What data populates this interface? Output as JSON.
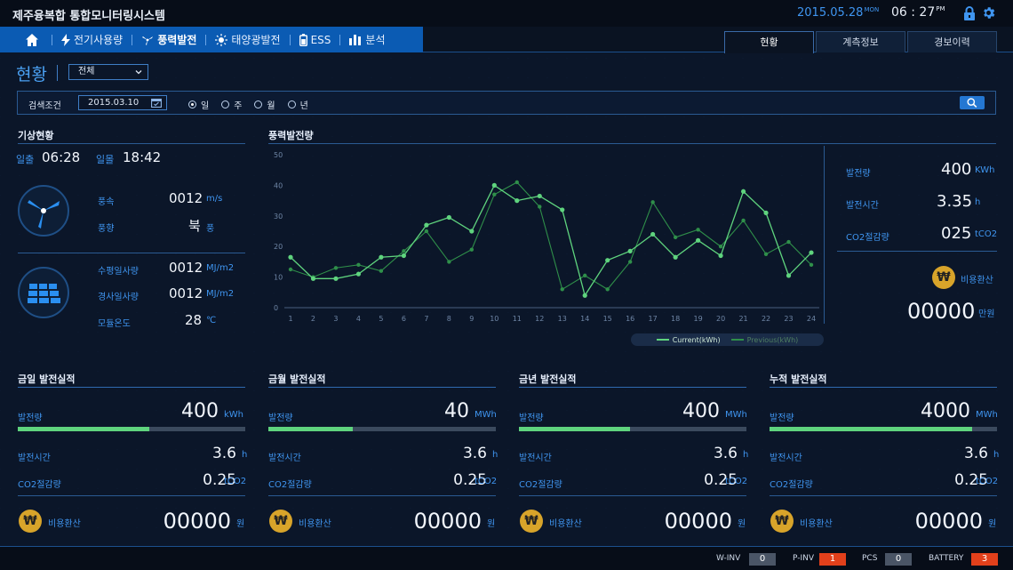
{
  "header": {
    "title": "제주융복합 통합모니터링시스템",
    "date": "2015.05.28",
    "day": "MON",
    "time": "06 : 27",
    "ampm": "PM"
  },
  "nav": {
    "items": [
      {
        "label": "전기사용량",
        "icon": "bolt-icon"
      },
      {
        "label": "풍력발전",
        "icon": "wind-turbine-icon"
      },
      {
        "label": "태양광발전",
        "icon": "sun-icon"
      },
      {
        "label": "ESS",
        "icon": "battery-icon"
      },
      {
        "label": "분석",
        "icon": "bar-chart-icon"
      }
    ],
    "active_index": 1
  },
  "tabs": {
    "items": [
      "현황",
      "계측정보",
      "경보이력"
    ],
    "active_index": 0
  },
  "page": {
    "title": "현황",
    "site_select": "전체"
  },
  "search": {
    "label": "검색조건",
    "date": "2015.03.10",
    "periods": [
      "일",
      "주",
      "월",
      "년"
    ],
    "selected_period": "일"
  },
  "weather": {
    "title": "기상현황",
    "sunrise_label": "일출",
    "sunrise": "06:28",
    "sunset_label": "일몰",
    "sunset": "18:42",
    "wind_speed_label": "풍속",
    "wind_speed": "0012",
    "wind_speed_unit": "m/s",
    "wind_dir_label": "풍향",
    "wind_dir": "북",
    "wind_dir_unit": "풍",
    "horizontal_label": "수평일사량",
    "horizontal": "0012",
    "horizontal_unit": "MJ/m2",
    "inclined_label": "경사일사량",
    "inclined": "0012",
    "inclined_unit": "MJ/m2",
    "module_temp_label": "모듈온도",
    "module_temp": "28",
    "module_temp_unit": "℃"
  },
  "wind_power": {
    "title": "풍력발전량",
    "generation_label": "발전량",
    "generation": "400",
    "generation_unit": "KWh",
    "hours_label": "발전시간",
    "hours": "3.35",
    "hours_unit": "h",
    "co2_label": "CO2절감량",
    "co2": "025",
    "co2_unit": "tCO2",
    "cost_label": "비용환산",
    "cost": "00000",
    "cost_unit": "만원"
  },
  "chart_data": {
    "type": "line",
    "x": [
      1,
      2,
      3,
      4,
      5,
      6,
      7,
      8,
      9,
      10,
      11,
      12,
      13,
      14,
      15,
      16,
      17,
      18,
      19,
      20,
      21,
      22,
      23,
      24
    ],
    "ylim": [
      0,
      50
    ],
    "yticks": [
      0,
      10,
      20,
      30,
      40,
      50
    ],
    "series": [
      {
        "name": "Current(kWh)",
        "color": "#5fd47e",
        "values": [
          16.5,
          9.5,
          9.5,
          11,
          16.5,
          17,
          27,
          29.5,
          25,
          40,
          35,
          36.5,
          32,
          4,
          15.5,
          18.5,
          24,
          16.5,
          22,
          17,
          38,
          31,
          10.5,
          18
        ]
      },
      {
        "name": "Previous(kWh)",
        "color": "#2f8f4a",
        "values": [
          12.5,
          10,
          13,
          14,
          12,
          18.5,
          25,
          15,
          19,
          37,
          41,
          33,
          6,
          10.5,
          6,
          15,
          34.5,
          23,
          25.5,
          20,
          28.5,
          17.5,
          21.5,
          14
        ]
      }
    ]
  },
  "footer_panels": [
    {
      "title": "금일 발전실적",
      "gen_label": "발전량",
      "gen": "400",
      "gen_unit": "kWh",
      "progress": 0.58,
      "hours_label": "발전시간",
      "hours": "3.6",
      "hours_unit": "h",
      "co2_label": "CO2절감량",
      "co2": "0.25",
      "co2_unit": "tCO2",
      "cost_label": "비용환산",
      "cost": "00000",
      "cost_unit": "원"
    },
    {
      "title": "금월 발전실적",
      "gen_label": "발전량",
      "gen": "40",
      "gen_unit": "MWh",
      "progress": 0.37,
      "hours_label": "발전시간",
      "hours": "3.6",
      "hours_unit": "h",
      "co2_label": "CO2절감량",
      "co2": "0.25",
      "co2_unit": "tCO2",
      "cost_label": "비용환산",
      "cost": "00000",
      "cost_unit": "원"
    },
    {
      "title": "금년 발전실적",
      "gen_label": "발전량",
      "gen": "400",
      "gen_unit": "MWh",
      "progress": 0.49,
      "hours_label": "발전시간",
      "hours": "3.6",
      "hours_unit": "h",
      "co2_label": "CO2절감량",
      "co2": "0.25",
      "co2_unit": "tCO2",
      "cost_label": "비용환산",
      "cost": "00000",
      "cost_unit": "원"
    },
    {
      "title": "누적 발전실적",
      "gen_label": "발전량",
      "gen": "4000",
      "gen_unit": "MWh",
      "progress": 0.89,
      "hours_label": "발전시간",
      "hours": "3.6",
      "hours_unit": "h",
      "co2_label": "CO2절감량",
      "co2": "0.25",
      "co2_unit": "tCO2",
      "cost_label": "비용환산",
      "cost": "00000",
      "cost_unit": "원"
    }
  ],
  "status": [
    {
      "label": "W-INV",
      "value": "0",
      "color": "#4a5566"
    },
    {
      "label": "P-INV",
      "value": "1",
      "color": "#e2401b"
    },
    {
      "label": "PCS",
      "value": "0",
      "color": "#4a5566"
    },
    {
      "label": "BATTERY",
      "value": "3",
      "color": "#e2401b"
    }
  ],
  "currency_symbol": "₩"
}
